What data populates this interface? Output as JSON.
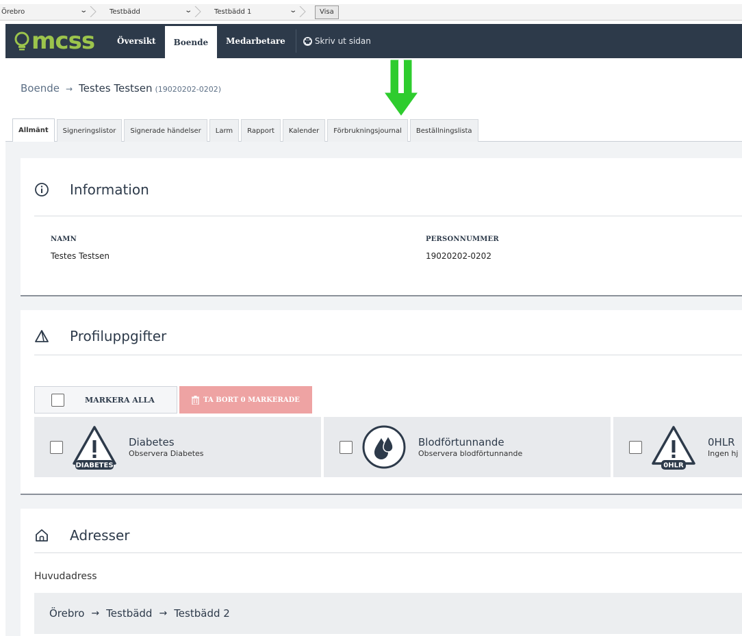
{
  "filter": {
    "selects": [
      "Örebro",
      "Testbädd",
      "Testbädd 1"
    ],
    "visa_label": "Visa"
  },
  "nav": {
    "logo_text": "mcss",
    "items": [
      "Översikt",
      "Boende",
      "Medarbetare"
    ],
    "active": "Boende",
    "print_label": "Skriv ut sidan"
  },
  "breadcrumb": {
    "root": "Boende",
    "name": "Testes Testsen",
    "personnummer": "(19020202-0202)"
  },
  "tabs": [
    "Allmänt",
    "Signeringslistor",
    "Signerade händelser",
    "Larm",
    "Rapport",
    "Kalender",
    "Förbrukningsjournal",
    "Beställningslista"
  ],
  "active_tab": "Allmänt",
  "information": {
    "title": "Information",
    "name_label": "NAMN",
    "name_value": "Testes Testsen",
    "pn_label": "PERSONNUMMER",
    "pn_value": "19020202-0202"
  },
  "profile": {
    "title": "Profiluppgifter",
    "mark_all_label": "MARKERA ALLA",
    "delete_label": "TA BORT 0 MARKERADE",
    "items": [
      {
        "title": "Diabetes",
        "subtitle": "Observera Diabetes",
        "icon_label": "DIABETES"
      },
      {
        "title": "Blodförtunnande",
        "subtitle": "Observera blodförtunnande"
      },
      {
        "title": "0HLR",
        "subtitle": "Ingen hj",
        "icon_label": "0HLR"
      }
    ]
  },
  "addresses": {
    "title": "Adresser",
    "main_label": "Huvudadress",
    "path": [
      "Örebro",
      "Testbädd",
      "Testbädd 2"
    ]
  },
  "colors": {
    "nav_bg": "#2d3a4a",
    "logo": "#9cc44c",
    "annotation_arrow": "#2ecc2e",
    "delete_btn": "#eea3a3"
  }
}
